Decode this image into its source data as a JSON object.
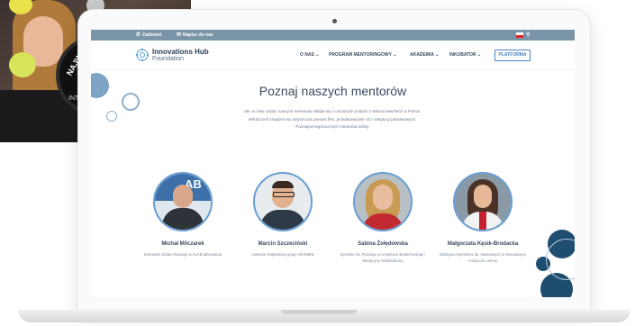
{
  "background_photo": {
    "badge_text": "NAJWY",
    "badge_sub": "INT"
  },
  "topbar": {
    "items": [
      {
        "icon": "phone-icon",
        "label": "Zadzwoń"
      },
      {
        "icon": "mail-icon",
        "label": "Napisz do nas"
      }
    ],
    "language_flag": "flag-pl-icon",
    "search_icon": "search-icon"
  },
  "header": {
    "logo_line1": "Innovations Hub",
    "logo_line2": "Foundation",
    "menu": [
      {
        "label": "O NAS ⌄"
      },
      {
        "label": "PROGRAM MENTORINGOWY ⌄"
      },
      {
        "label": "AKADEMIA ⌄"
      },
      {
        "label": "INKUBATOR ⌄"
      }
    ],
    "platform_button": "PLATFORMA"
  },
  "main": {
    "title": "Poznaj naszych mentorów",
    "intro": "Jak co roku nasięć naszych mentorów składa się z cenionych postaci z sektora MedTech w Polsce. Wśród nich znajdzie się dotychczas prezesi firm, przedstawiciele VC i instytucji państwowych. Poznajcie tegorocznych mentorów bliżej!",
    "mentors": [
      {
        "name": "Michał Milczarek",
        "role": "Kierownik działu Rozwoju w ALAB laboratoria",
        "avatar_bg": "#3d6fa8"
      },
      {
        "name": "Marcin Szczeciński",
        "role": "Inwestor Kapitałowy grupy ADAMED",
        "avatar_bg": "#e8ecef"
      },
      {
        "name": "Sabina Żołędowska",
        "role": "Dyrektor ds. Rozwoju w Instytucie Biotechnologii i Medycyny Molekularnej",
        "avatar_bg": "#b8c0c6"
      },
      {
        "name": "Małgorzata Kęsik-Brodacka",
        "role": "Zastępca Dyrektora ds. Naukowych w Narodowym Instytucie Leków",
        "avatar_bg": "#8a99a6"
      }
    ]
  },
  "colors": {
    "accent": "#4a82c4",
    "topbar": "#7b95a8",
    "deco_navy": "#1f4d70",
    "text": "#3b4a5e"
  }
}
